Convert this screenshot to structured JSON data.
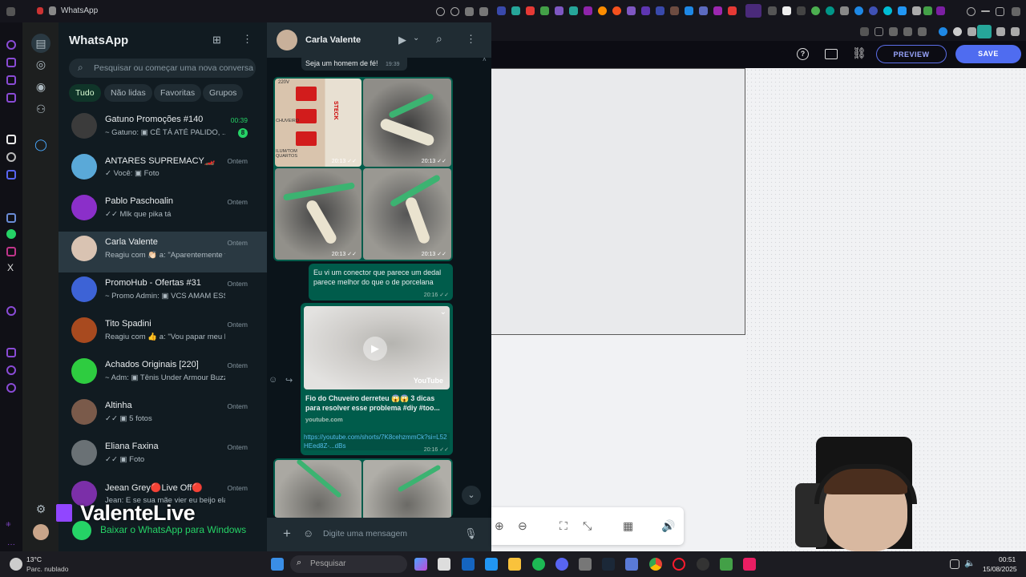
{
  "browser": {
    "tab_title": "WhatsApp"
  },
  "whatsapp": {
    "title": "WhatsApp",
    "search_placeholder": "Pesquisar ou começar uma nova conversa",
    "filters": [
      "Tudo",
      "Não lidas",
      "Favoritas",
      "Grupos"
    ],
    "chats": [
      {
        "name": "Gatuno Promoções #140",
        "preview": "~ Gatuno: ▣ CÊ TÁ ATÉ PALIDO, ...",
        "time": "00:39",
        "unread": "8",
        "time_green": true
      },
      {
        "name": "ANTARES SUPREMACY🏎️",
        "preview": "✓ Você: ▣ Foto",
        "time": "Ontem"
      },
      {
        "name": "Pablo Paschoalin",
        "preview": "✓✓ Mlk que pika tá",
        "time": "Ontem"
      },
      {
        "name": "Carla Valente",
        "preview": "Reagiu com 👏🏻 a: \"Aparentemente tá fu...",
        "time": "Ontem",
        "selected": true
      },
      {
        "name": "PromoHub - Ofertas #31",
        "preview": "~ Promo Admin: ▣ VCS AMAM ESSA...",
        "time": "Ontem"
      },
      {
        "name": "Tito Spadini",
        "preview": "Reagiu com 👍 a: \"Vou papar meu banh...",
        "time": "Ontem"
      },
      {
        "name": "Achados Originais [220]",
        "preview": "~ Adm: ▣ Tênis Under Armour Buzze...",
        "time": "Ontem"
      },
      {
        "name": "Altinha",
        "preview": "✓✓ ▣ 5 fotos",
        "time": "Ontem"
      },
      {
        "name": "Eliana Faxina",
        "preview": "✓✓ ▣ Foto",
        "time": "Ontem"
      },
      {
        "name": "Jeean Grey🔴Live Off🔴",
        "preview": "Jean: E se sua mãe vier eu beijo ela ta...",
        "time": "Ontem"
      }
    ],
    "overlay_name": "ValenteLive",
    "download_text": "Baixar o WhatsApp para Windows"
  },
  "conversation": {
    "contact": "Carla Valente",
    "top_message": "Seja um homem de fé!",
    "top_time": "19:39",
    "image_times": [
      "20:13 ✓✓",
      "20:13 ✓✓",
      "20:13 ✓✓",
      "20:13 ✓✓"
    ],
    "image_labels": [
      "220V",
      "CHUVEIRO",
      "STECK",
      "ILUM/TOM QUARTOS"
    ],
    "text_message": "Eu vi um conector que parece um dedal parece melhor do que o de porcelana",
    "text_time": "20:16 ✓✓",
    "link_title": "Fio do Chuveiro derreteu 😱😱 3 dicas para resolver esse problema #diy #too...",
    "link_domain": "youtube.com",
    "link_url": "https://youtube.com/shorts/7K8cehzmmCk?si=L52HEed8Z-...dBs",
    "link_time": "20:16 ✓✓",
    "youtube_label": "YouTube",
    "composer_placeholder": "Digite uma mensagem"
  },
  "editor": {
    "preview_label": "PREVIEW",
    "save_label": "SAVE"
  },
  "taskbar": {
    "weather_temp": "13°C",
    "weather_desc": "Parc. nublado",
    "search_placeholder": "Pesquisar",
    "time": "00:51",
    "date": "15/08/2025"
  }
}
